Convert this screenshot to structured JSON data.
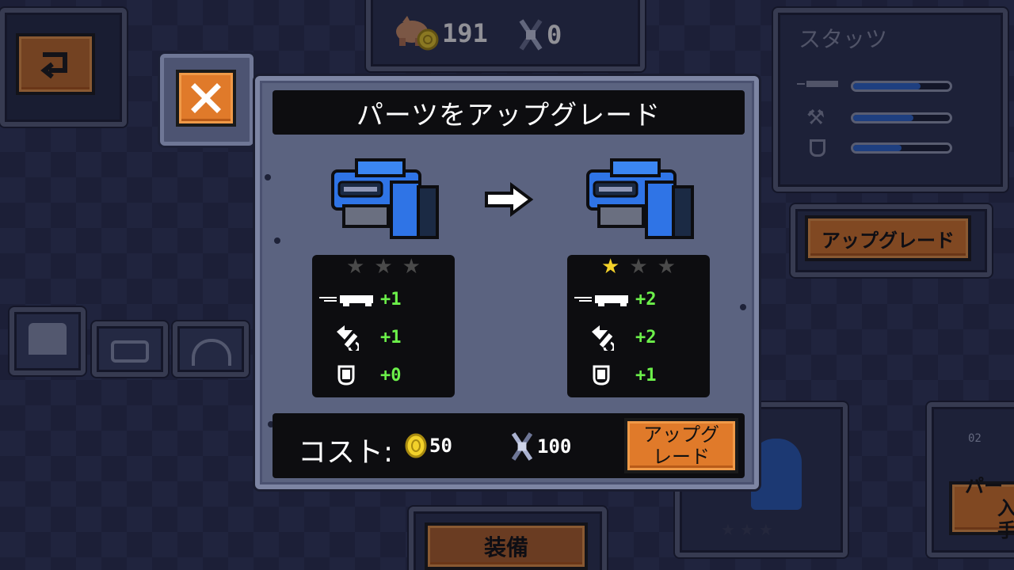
{
  "hud": {
    "coins": "191",
    "scrap": "0"
  },
  "background": {
    "stats_title": "スタッツ",
    "stats_bars": [
      0.7,
      0.62,
      0.5
    ],
    "upgrade_label": "アップグレード",
    "equip_label": "装備",
    "parts_label_line1": "パー",
    "parts_label_line2": "入手",
    "badge": "02"
  },
  "modal": {
    "title": "パーツをアップグレード",
    "current": {
      "stars_filled": 0,
      "stars_total": 3,
      "stats": [
        {
          "icon": "gun-icon",
          "value": "+1"
        },
        {
          "icon": "wrench-icon",
          "value": "+1"
        },
        {
          "icon": "shield-icon",
          "value": "+0"
        }
      ]
    },
    "next": {
      "stars_filled": 1,
      "stars_total": 3,
      "stats": [
        {
          "icon": "gun-icon",
          "value": "+2"
        },
        {
          "icon": "wrench-icon",
          "value": "+2"
        },
        {
          "icon": "shield-icon",
          "value": "+1"
        }
      ]
    },
    "cost_label": "コスト:",
    "cost_coins": "50",
    "cost_scrap": "100",
    "upgrade_button_line1": "アップグ",
    "upgrade_button_line2": "レード"
  },
  "colors": {
    "accent_orange": "#e07a2a",
    "stat_green": "#6cf04a",
    "star_yellow": "#f4d22a",
    "bar_blue": "#2f6bd6"
  }
}
